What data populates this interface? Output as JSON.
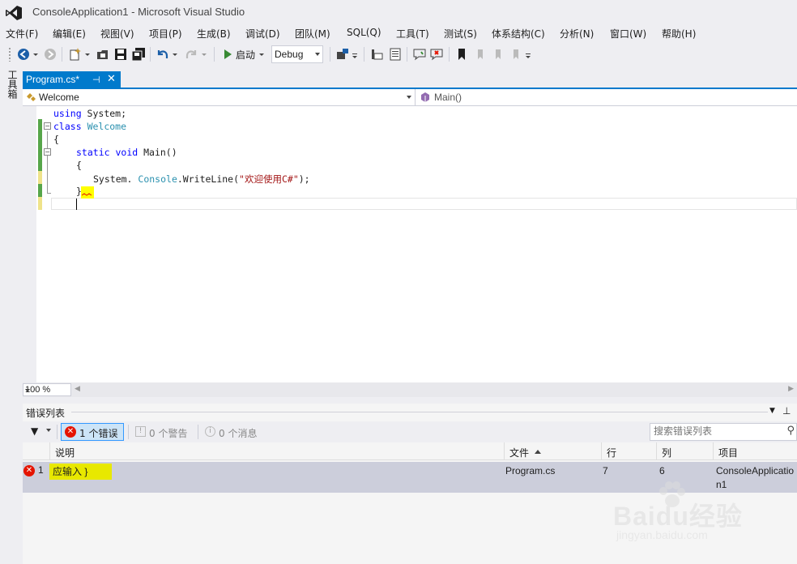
{
  "window": {
    "title": "ConsoleApplication1 - Microsoft Visual Studio"
  },
  "menu": [
    "文件(F)",
    "编辑(E)",
    "视图(V)",
    "项目(P)",
    "生成(B)",
    "调试(D)",
    "团队(M)",
    "SQL(Q)",
    "工具(T)",
    "测试(S)",
    "体系结构(C)",
    "分析(N)",
    "窗口(W)",
    "帮助(H)"
  ],
  "toolbar": {
    "start_label": "启动",
    "config_value": "Debug"
  },
  "toolbox": {
    "label": "工具箱"
  },
  "document_tab": {
    "label": "Program.cs*"
  },
  "navbar": {
    "type_value": "Welcome",
    "member_value": "Main()"
  },
  "code": {
    "line1_kw": "using",
    "line1_rest": " System;",
    "line2_kw": "class",
    "line2_type": "Welcome",
    "line3": "{",
    "line4_kw1": "static",
    "line4_kw2": "void",
    "line4_rest": " Main()",
    "line5": "{",
    "line6_a": "System.",
    "line6_type": "Console",
    "line6_b": ".WriteLine(",
    "line6_str": "\"欢迎使用C#\"",
    "line6_c": ");",
    "line7": "}"
  },
  "zoom": {
    "value": "100 %"
  },
  "error_list": {
    "title": "错误列表",
    "errors_label": "1 个错误",
    "warnings_label": "0 个警告",
    "messages_label": "0 个消息",
    "search_placeholder": "搜索错误列表",
    "columns": {
      "description": "说明",
      "file": "文件",
      "line": "行",
      "column": "列",
      "project": "项目"
    },
    "rows": [
      {
        "index": "1",
        "description": "应输入 }",
        "file": "Program.cs",
        "line": "7",
        "column": "6",
        "project": "ConsoleApplication1"
      }
    ]
  },
  "watermark": {
    "brand": "Baidu经验",
    "url": "jingyan.baidu.com"
  },
  "colors": {
    "accent": "#007acc",
    "error": "#e51400",
    "highlight": "#ffff00",
    "change_saved": "#57a64a",
    "change_unsaved": "#efe38a"
  }
}
